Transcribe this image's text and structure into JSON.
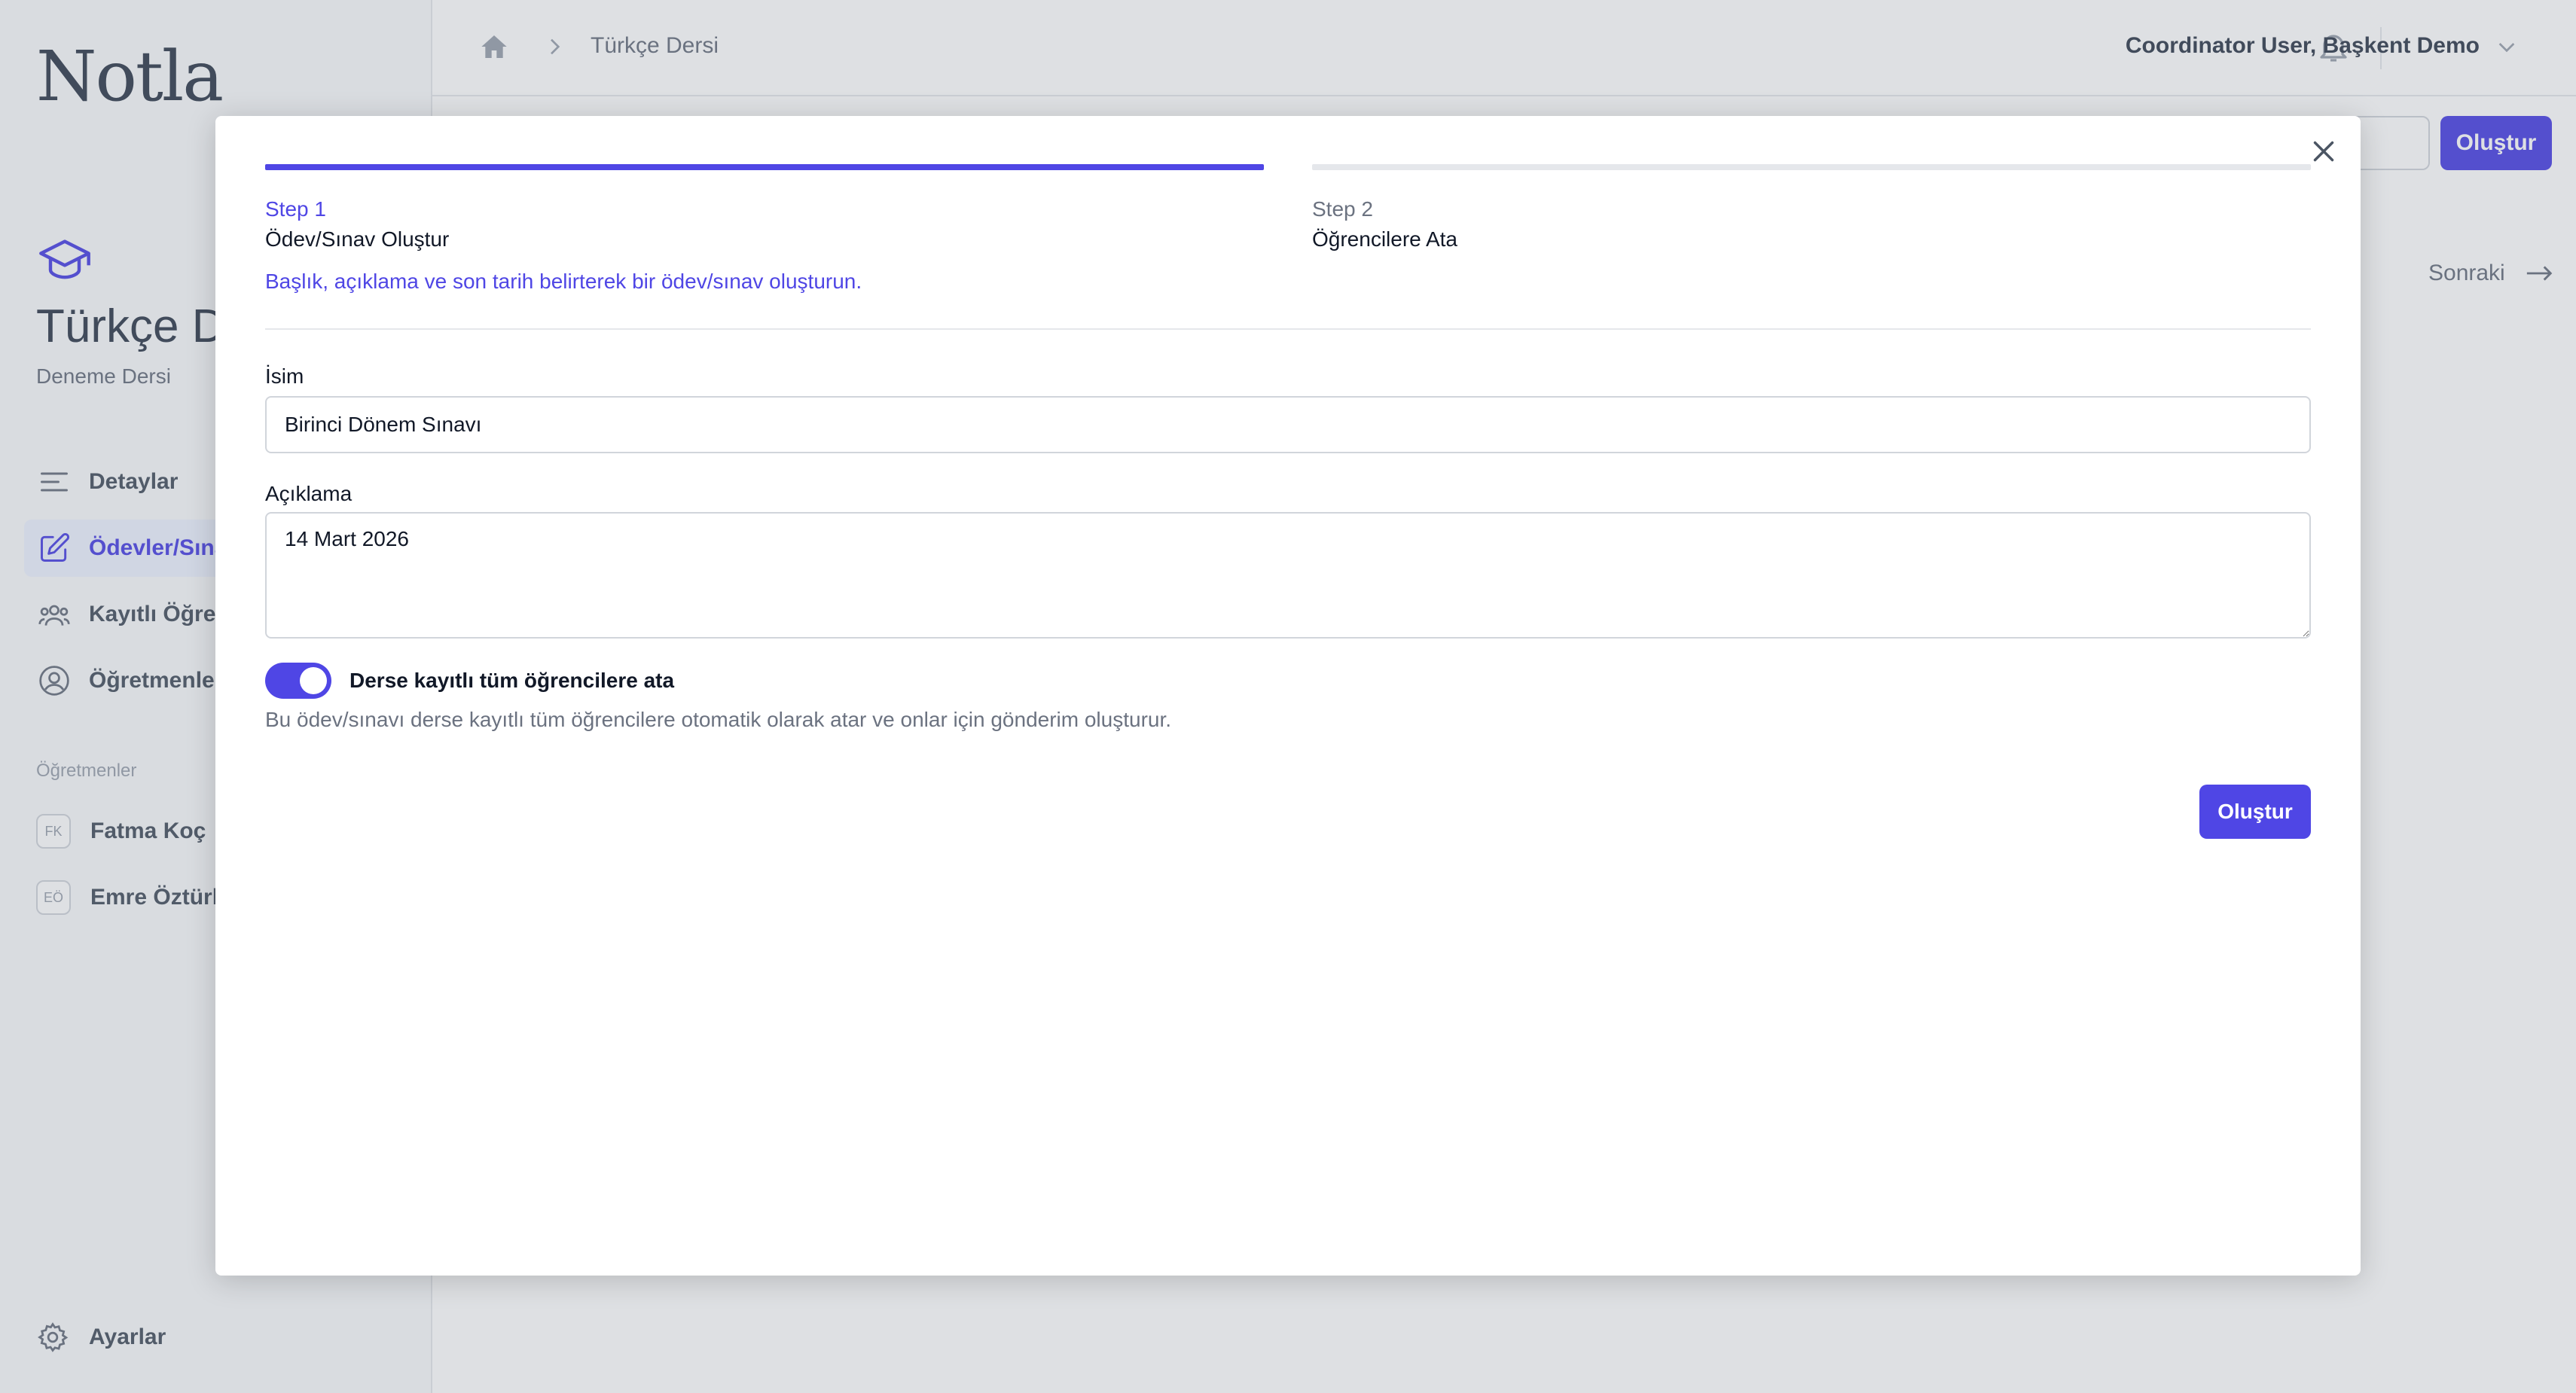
{
  "sidebar": {
    "logo": "Notla",
    "course_title": "Türkçe Dersi",
    "course_subtitle": "Deneme Dersi",
    "nav": [
      {
        "label": "Detaylar",
        "icon": "menu-lines-icon"
      },
      {
        "label": "Ödevler/Sınavlar",
        "icon": "pencil-square-icon"
      },
      {
        "label": "Kayıtlı Öğrenciler",
        "icon": "users-group-icon"
      },
      {
        "label": "Öğretmenler",
        "icon": "user-circle-icon"
      }
    ],
    "teachers_section": "Öğretmenler",
    "teachers": [
      {
        "initials": "FK",
        "name": "Fatma Koç"
      },
      {
        "initials": "EÖ",
        "name": "Emre Öztürk"
      }
    ],
    "settings": "Ayarlar"
  },
  "topbar": {
    "breadcrumb": "Türkçe Dersi",
    "user": "Coordinator User, Başkent Demo"
  },
  "background": {
    "create_button": "Oluştur",
    "next_link": "Sonraki"
  },
  "modal": {
    "steps": [
      {
        "num": "Step 1",
        "name": "Ödev/Sınav Oluştur"
      },
      {
        "num": "Step 2",
        "name": "Öğrencilere Ata"
      }
    ],
    "step_description": "Başlık, açıklama ve son tarih belirterek bir ödev/sınav oluşturun.",
    "name_label": "İsim",
    "name_value": "Birinci Dönem Sınavı",
    "description_label": "Açıklama",
    "description_value": "14 Mart 2026",
    "toggle_label": "Derse kayıtlı tüm öğrencilere ata",
    "toggle_help": "Bu ödev/sınavı derse kayıtlı tüm öğrencilere otomatik olarak atar ve onlar için gönderim oluşturur.",
    "submit_label": "Oluştur"
  },
  "colors": {
    "primary": "#4f46e5",
    "border": "#d1d5db",
    "muted": "#6b7280"
  }
}
